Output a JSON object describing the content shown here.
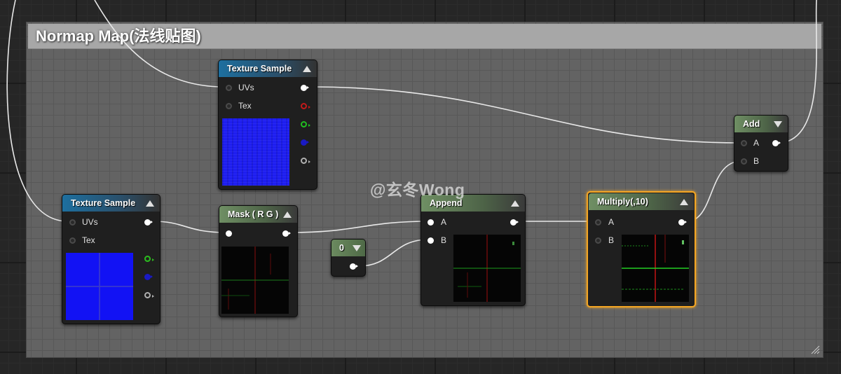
{
  "comment": {
    "title": "Normap Map(法线贴图)"
  },
  "nodes": {
    "texture_sample_top": {
      "title": "Texture Sample",
      "inputs": [
        "UVs",
        "Tex"
      ]
    },
    "texture_sample_left": {
      "title": "Texture Sample",
      "inputs": [
        "UVs",
        "Tex"
      ]
    },
    "mask": {
      "title": "Mask ( R G )"
    },
    "constant": {
      "value": "0"
    },
    "append": {
      "title": "Append",
      "inputs": [
        "A",
        "B"
      ]
    },
    "multiply": {
      "title": "Multiply(,10)",
      "inputs": [
        "A",
        "B"
      ]
    },
    "add": {
      "title": "Add",
      "inputs": [
        "A",
        "B"
      ]
    }
  },
  "watermark": "@玄冬Wong",
  "colors": {
    "header_blue": "#1d6f9f",
    "header_green": "#6f8f64",
    "selection": "#f5a623",
    "pin_red": "#c41a1a",
    "pin_green": "#20c020",
    "pin_blue": "#1a1ac4"
  }
}
